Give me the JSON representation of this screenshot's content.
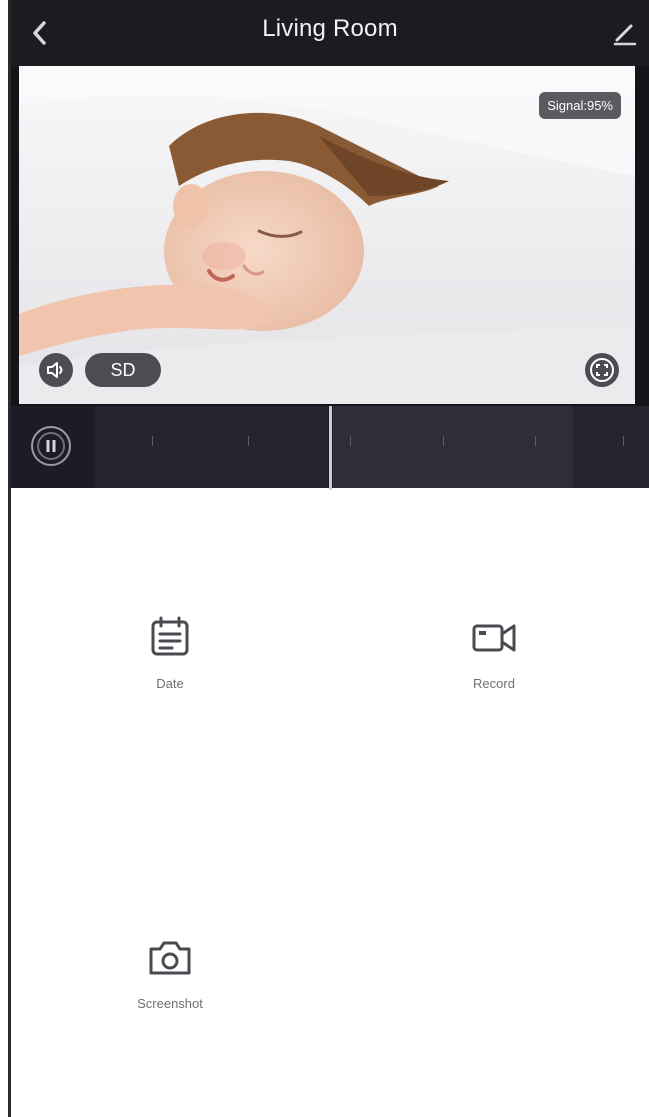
{
  "header": {
    "title": "Living Room",
    "back_icon": "chevron-left-icon",
    "edit_icon": "pencil-icon"
  },
  "video": {
    "signal_label": "Signal:95%",
    "quality_label": "SD",
    "audio_icon": "speaker-icon",
    "fullscreen_icon": "fullscreen-icon"
  },
  "timeline": {
    "play_icon": "pause-icon",
    "labels": [
      "",
      "",
      "",
      "",
      "",
      ""
    ]
  },
  "controls": {
    "date_label": "Date",
    "record_label": "Record",
    "screenshot_label": "Screenshot"
  },
  "colors": {
    "header_bg": "#1b1b22",
    "timeline_bg": "#1c1d24",
    "button_bg": "#4c4c52"
  }
}
